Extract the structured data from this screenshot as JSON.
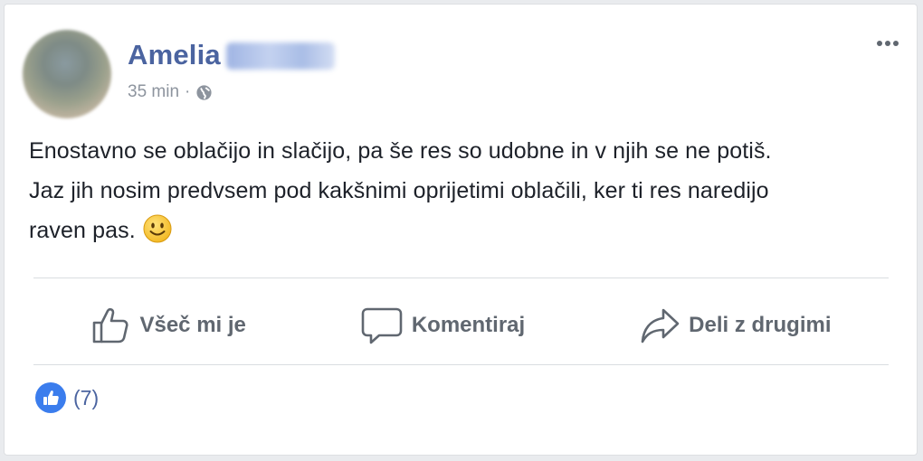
{
  "post": {
    "author_first_name": "Amelia",
    "timestamp": "35 min",
    "separator": "·",
    "privacy_icon": "globe-icon",
    "text_line1": "Enostavno se oblačijo in slačijo, pa še res so udobne in v njih se ne potiš.",
    "text_line2": "Jaz jih nosim predvsem pod kakšnimi oprijetimi oblačili, ker ti res naredijo",
    "text_line3": "raven pas.",
    "emoji": "smiley-icon"
  },
  "actions": {
    "like_label": "Všeč mi je",
    "comment_label": "Komentiraj",
    "share_label": "Deli z drugimi"
  },
  "reactions": {
    "count_text": "(7)",
    "icon": "thumbs-up-badge-icon"
  },
  "colors": {
    "author": "#4b64a0",
    "like_badge": "#3b7ded",
    "text": "#1d2129",
    "muted": "#606770"
  }
}
